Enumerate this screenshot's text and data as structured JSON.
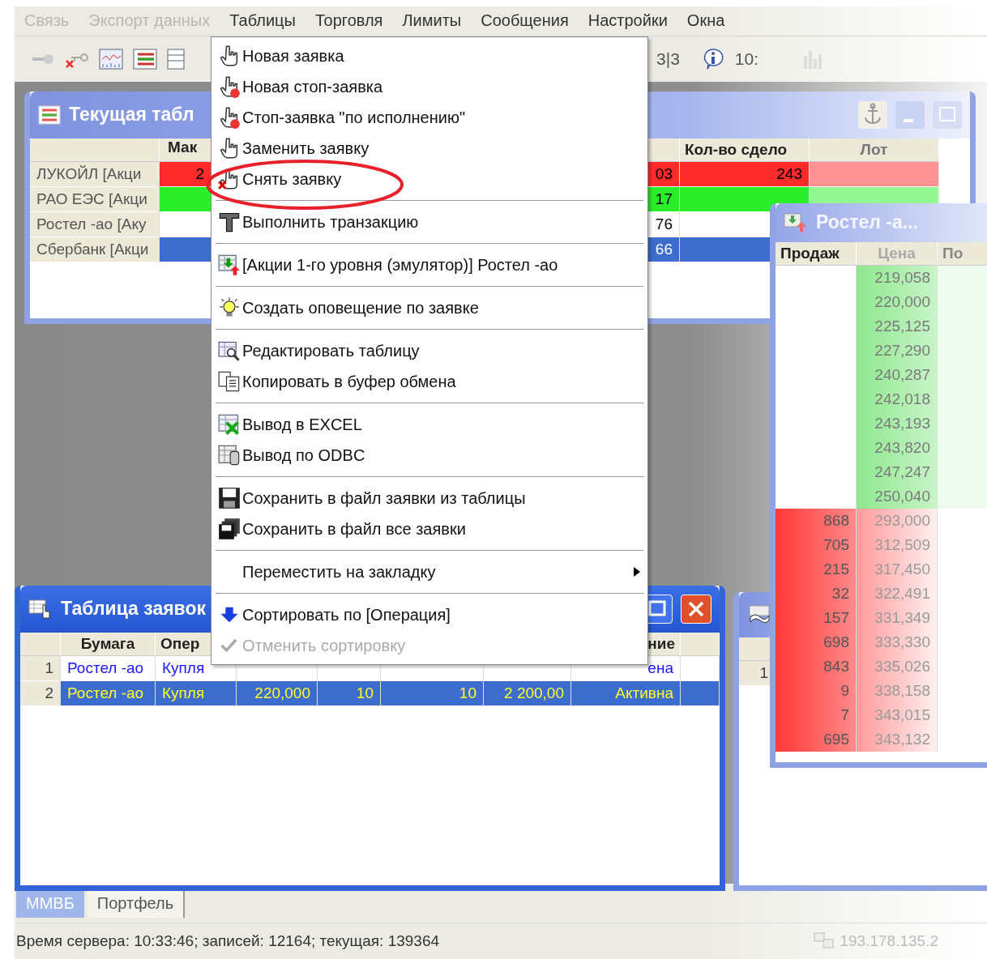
{
  "menu_bar": [
    {
      "label": "Связь",
      "disabled": true
    },
    {
      "label": "Экспорт данных",
      "disabled": true
    },
    {
      "label": "Таблицы",
      "disabled": false
    },
    {
      "label": "Торговля",
      "disabled": false
    },
    {
      "label": "Лимиты",
      "disabled": false
    },
    {
      "label": "Сообщения",
      "disabled": false
    },
    {
      "label": "Настройки",
      "disabled": false
    },
    {
      "label": "Окна",
      "disabled": false
    }
  ],
  "toolbar": {
    "counter": "3|3",
    "clock": "10:"
  },
  "quotes_window": {
    "title": "Текущая табл",
    "columns": {
      "max": "Мак",
      "deals": "Кол-во сдело",
      "lot": "Лот"
    },
    "rows": [
      {
        "name": "ЛУКОЙЛ [Акци",
        "max": "2",
        "column_3": "03",
        "deals": "243",
        "color": "#ff2a2a",
        "selected": false
      },
      {
        "name": "РАО ЕЭС [Акци",
        "column_3": "17",
        "color": "#2aee2a",
        "selected": false
      },
      {
        "name": "Ростел -ао [Аку",
        "column_3": "76",
        "selected": false
      },
      {
        "name": "Сбербанк [Акци",
        "column_3": "66",
        "selected": true
      }
    ]
  },
  "order_book": {
    "title": "Ростел -а...",
    "columns": {
      "sell": "Продаж",
      "price": "Цена",
      "column_3": "По"
    },
    "rows": [
      {
        "kind": "offer",
        "price": "219,058"
      },
      {
        "kind": "offer",
        "price": "220,000"
      },
      {
        "kind": "offer",
        "price": "225,125"
      },
      {
        "kind": "offer",
        "price": "227,290"
      },
      {
        "kind": "offer",
        "price": "240,287"
      },
      {
        "kind": "offer",
        "price": "242,018"
      },
      {
        "kind": "offer",
        "price": "243,193"
      },
      {
        "kind": "offer",
        "price": "243,820"
      },
      {
        "kind": "offer",
        "price": "247,247"
      },
      {
        "kind": "offer",
        "price": "250,040"
      },
      {
        "kind": "bid",
        "volume": "868",
        "price": "293,000"
      },
      {
        "kind": "bid",
        "volume": "705",
        "price": "312,509"
      },
      {
        "kind": "bid",
        "volume": "215",
        "price": "317,450"
      },
      {
        "kind": "bid",
        "volume": "32",
        "price": "322,491"
      },
      {
        "kind": "bid",
        "volume": "157",
        "price": "331,349"
      },
      {
        "kind": "bid",
        "volume": "698",
        "price": "333,330"
      },
      {
        "kind": "bid",
        "volume": "843",
        "price": "335,026"
      },
      {
        "kind": "bid",
        "volume": "9",
        "price": "338,158"
      },
      {
        "kind": "bid",
        "volume": "7",
        "price": "343,015"
      },
      {
        "kind": "bid",
        "volume": "695",
        "price": "343,132"
      }
    ]
  },
  "orders_window": {
    "title": "Таблица заявок",
    "columns": {
      "security": "Бумага",
      "operation": "Опер",
      "column_8": "ние"
    },
    "rows": [
      {
        "number": "1",
        "security": "Ростел -ао",
        "operation": "Купля",
        "column_8": "ена",
        "selected": false
      },
      {
        "number": "2",
        "security": "Ростел -ао",
        "operation": "Купля",
        "column_4": "220,000",
        "column_5": "10",
        "column_6": "10",
        "column_7": "2 200,00",
        "column_8": "Активна",
        "selected": true
      }
    ]
  },
  "trades_window": {
    "rows": [
      {
        "number": "1"
      }
    ]
  },
  "context_menu": {
    "items": [
      {
        "kind": "item",
        "label": "Новая заявка",
        "disabled": false
      },
      {
        "kind": "item",
        "label": "Новая стоп-заявка",
        "disabled": false
      },
      {
        "kind": "item",
        "label": "Стоп-заявка \"по исполнению\"",
        "disabled": false
      },
      {
        "kind": "item",
        "label": "Заменить заявку",
        "disabled": false
      },
      {
        "kind": "item",
        "label": "Снять заявку",
        "disabled": false
      },
      {
        "kind": "separator"
      },
      {
        "kind": "item",
        "label": "Выполнить транзакцию",
        "disabled": false
      },
      {
        "kind": "separator"
      },
      {
        "kind": "item",
        "label": "[Акции 1-го уровня (эмулятор)] Ростел -ао",
        "disabled": false
      },
      {
        "kind": "separator"
      },
      {
        "kind": "item",
        "label": "Создать оповещение по заявке",
        "disabled": false
      },
      {
        "kind": "separator"
      },
      {
        "kind": "item",
        "label": "Редактировать таблицу",
        "disabled": false
      },
      {
        "kind": "item",
        "label": "Копировать в буфер обмена",
        "disabled": false
      },
      {
        "kind": "separator"
      },
      {
        "kind": "item",
        "label": "Вывод в EXCEL",
        "disabled": false
      },
      {
        "kind": "item",
        "label": "Вывод по ODBC",
        "disabled": false
      },
      {
        "kind": "separator"
      },
      {
        "kind": "item",
        "label": "Сохранить в файл заявки из таблицы",
        "disabled": false
      },
      {
        "kind": "item",
        "label": "Сохранить в файл все заявки",
        "disabled": false
      },
      {
        "kind": "separator"
      },
      {
        "kind": "submenu",
        "label": "Переместить на закладку",
        "disabled": false
      },
      {
        "kind": "separator"
      },
      {
        "kind": "item",
        "label": "Сортировать по [Операция]",
        "disabled": false
      },
      {
        "kind": "item",
        "label": "Отменить сортировку",
        "disabled": true
      }
    ]
  },
  "tabs": [
    {
      "label": "ММВБ",
      "selected": true
    },
    {
      "label": "Портфель",
      "selected": false
    }
  ],
  "status_bar": {
    "text": "Время сервера: 10:33:46; записей: 12164; текущая: 139364",
    "address": "193.178.135.2"
  }
}
